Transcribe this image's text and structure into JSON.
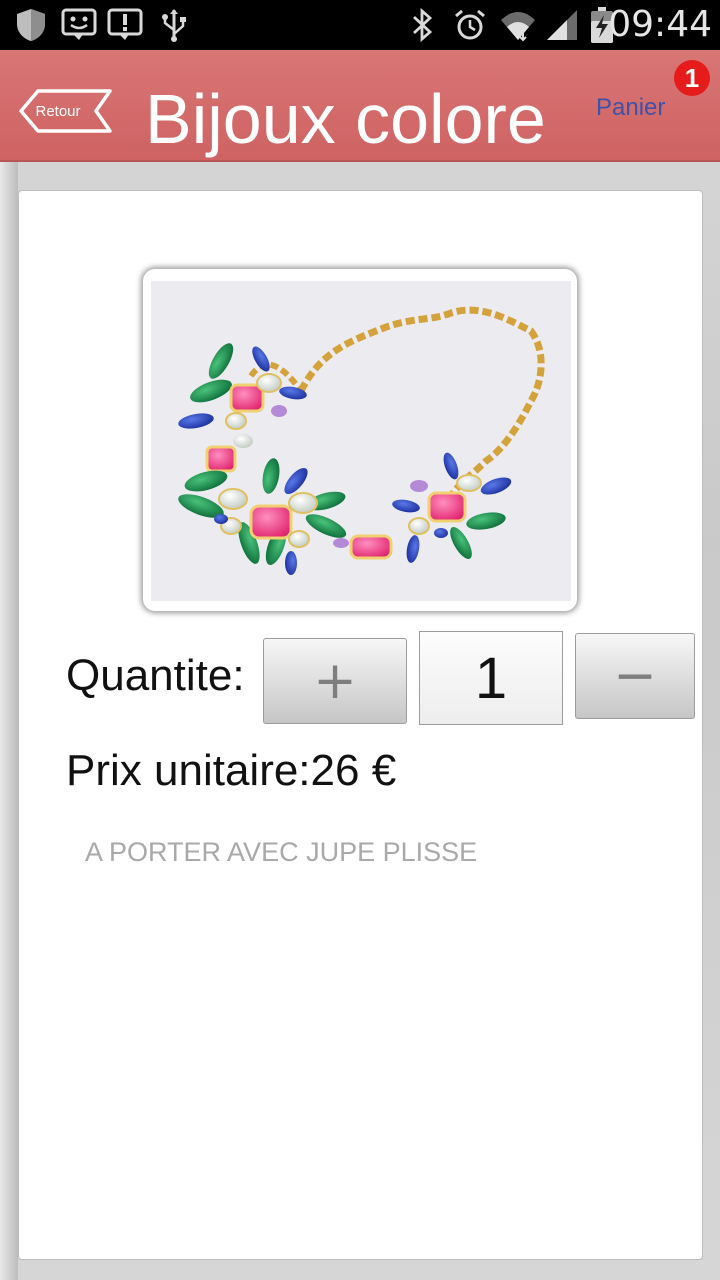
{
  "status_bar": {
    "time": "09:44",
    "icons": [
      "shield-icon",
      "smiley-message-icon",
      "alert-message-icon",
      "usb-icon",
      "bluetooth-icon",
      "alarm-icon",
      "wifi-icon",
      "signal-icon",
      "battery-charging-icon"
    ]
  },
  "header": {
    "back_label": "Retour",
    "title": "Bijoux colore",
    "cart_label": "Panier",
    "cart_count": "1"
  },
  "product": {
    "image_alt": "collier bijoux colore",
    "quantity_label": "Quantite:",
    "plus_label": "+",
    "quantity_value": "1",
    "minus_label": "−",
    "price_text": "Prix unitaire:26 €",
    "description": "A PORTER AVEC JUPE PLISSE"
  },
  "colors": {
    "header": "#d06a6a",
    "badge": "#e61b1b",
    "cart_link": "#3f51a8",
    "description": "#a9a9a9"
  }
}
